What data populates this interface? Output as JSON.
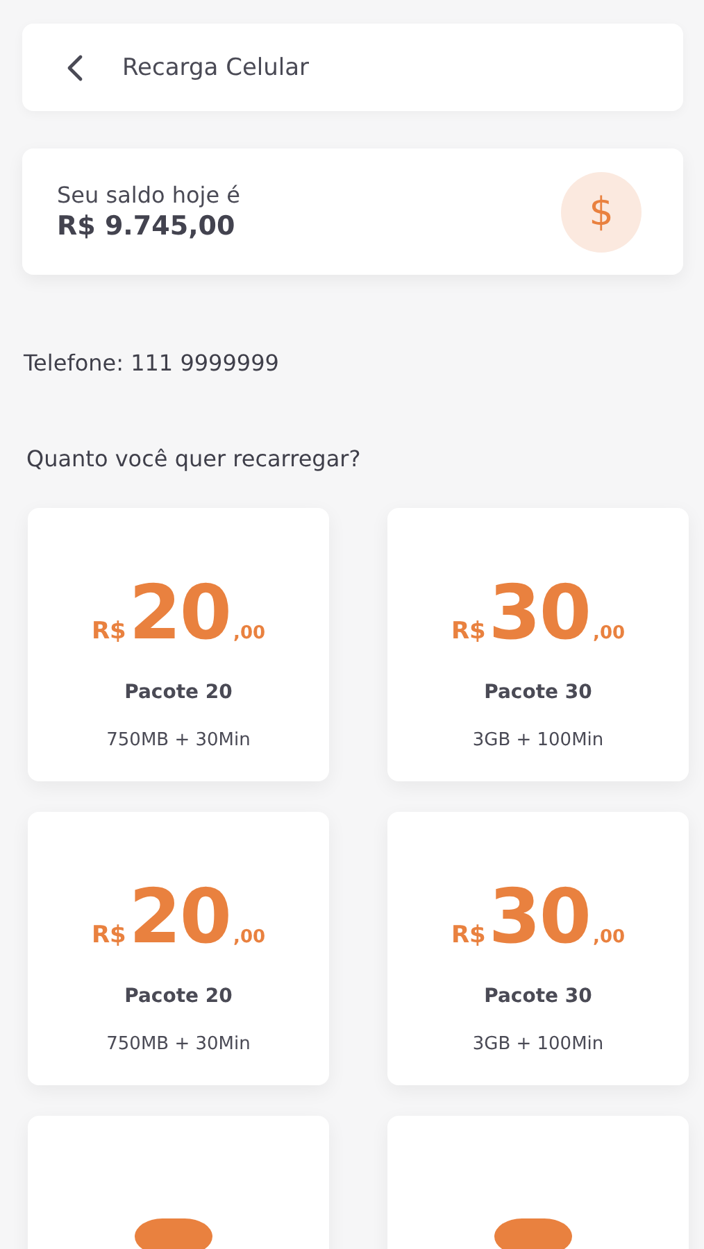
{
  "header": {
    "title": "Recarga Celular"
  },
  "balance": {
    "label": "Seu saldo hoje é",
    "amount": "R$ 9.745,00",
    "icon_glyph": "$"
  },
  "phone": "Telefone: 111 9999999",
  "question": "Quanto você quer recarregar?",
  "packages": [
    {
      "currency": "R$",
      "whole": "20",
      "cents": ",00",
      "name": "Pacote 20",
      "detail": "750MB + 30Min"
    },
    {
      "currency": "R$",
      "whole": "30",
      "cents": ",00",
      "name": "Pacote 30",
      "detail": "3GB + 100Min"
    },
    {
      "currency": "R$",
      "whole": "20",
      "cents": ",00",
      "name": "Pacote 20",
      "detail": "750MB + 30Min"
    },
    {
      "currency": "R$",
      "whole": "30",
      "cents": ",00",
      "name": "Pacote 30",
      "detail": "3GB + 100Min"
    }
  ]
}
